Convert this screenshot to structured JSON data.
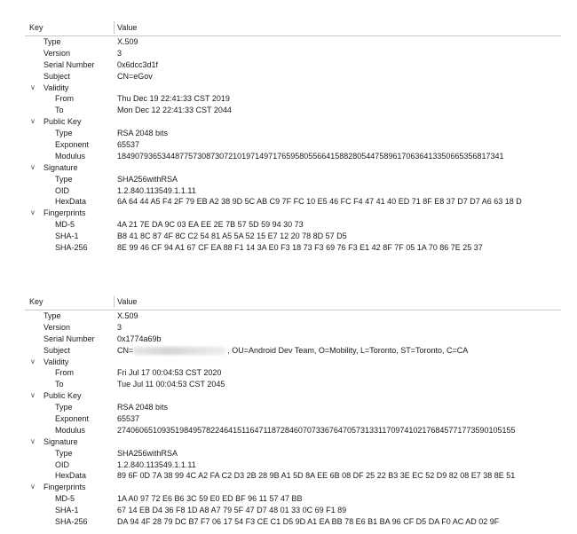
{
  "header": {
    "key_label": "Key",
    "value_label": "Value"
  },
  "certificates": [
    {
      "rows": [
        {
          "level": 1,
          "key": "Type",
          "value": "X.509"
        },
        {
          "level": 1,
          "key": "Version",
          "value": "3"
        },
        {
          "level": 1,
          "key": "Serial Number",
          "value": "0x6dcc3d1f"
        },
        {
          "level": 1,
          "key": "Subject",
          "value": "CN=eGov"
        },
        {
          "level": 1,
          "key": "Validity",
          "value": "",
          "group": true
        },
        {
          "level": 2,
          "key": "From",
          "value": "Thu Dec 19 22:41:33 CST 2019"
        },
        {
          "level": 2,
          "key": "To",
          "value": "Mon Dec 12 22:41:33 CST 2044"
        },
        {
          "level": 1,
          "key": "Public Key",
          "value": "",
          "group": true
        },
        {
          "level": 2,
          "key": "Type",
          "value": "RSA 2048 bits"
        },
        {
          "level": 2,
          "key": "Exponent",
          "value": "65537"
        },
        {
          "level": 2,
          "key": "Modulus",
          "value": "184907936534487757308730721019714971765958055664158828054475896170636413350665356817341"
        },
        {
          "level": 1,
          "key": "Signature",
          "value": "",
          "group": true
        },
        {
          "level": 2,
          "key": "Type",
          "value": "SHA256withRSA"
        },
        {
          "level": 2,
          "key": "OID",
          "value": "1.2.840.113549.1.1.11"
        },
        {
          "level": 2,
          "key": "HexData",
          "value": "6A 64 44 A5 F4 2F 79 EB A2 38 9D 5C AB C9 7F FC 10 E5 46 FC F4 47 41 40 ED 71 8F E8 37 D7 D7 A6 63 18 D"
        },
        {
          "level": 1,
          "key": "Fingerprints",
          "value": "",
          "group": true
        },
        {
          "level": 2,
          "key": "MD-5",
          "value": "4A 21 7E DA 9C 03 EA EE 2E 7B 57 5D 59 94 30 73"
        },
        {
          "level": 2,
          "key": "SHA-1",
          "value": "B8 41 8C 87 4F 8C C2 54 81 A5 5A 52 15 E7 12 20 78 8D 57 D5"
        },
        {
          "level": 2,
          "key": "SHA-256",
          "value": "8E 99 46 CF 94 A1 67 CF EA 88 F1 14 3A E0 F3 18 73 F3 69 76 F3 E1 42 8F 7F 05 1A 70 86 7E 25 37"
        }
      ]
    },
    {
      "rows": [
        {
          "level": 1,
          "key": "Type",
          "value": "X.509"
        },
        {
          "level": 1,
          "key": "Version",
          "value": "3"
        },
        {
          "level": 1,
          "key": "Serial Number",
          "value": "0x1774a69b"
        },
        {
          "level": 1,
          "key": "Subject",
          "value": "CN=",
          "value_suffix": ", OU=Android Dev Team, O=Mobility, L=Toronto, ST=Toronto, C=CA",
          "redacted": true
        },
        {
          "level": 1,
          "key": "Validity",
          "value": "",
          "group": true
        },
        {
          "level": 2,
          "key": "From",
          "value": "Fri Jul 17 00:04:53 CST 2020"
        },
        {
          "level": 2,
          "key": "To",
          "value": "Tue Jul 11 00:04:53 CST 2045"
        },
        {
          "level": 1,
          "key": "Public Key",
          "value": "",
          "group": true
        },
        {
          "level": 2,
          "key": "Type",
          "value": "RSA 2048 bits"
        },
        {
          "level": 2,
          "key": "Exponent",
          "value": "65537"
        },
        {
          "level": 2,
          "key": "Modulus",
          "value": "274060651093519849578224641511647118728460707336764705731331170974102176845771773590105155"
        },
        {
          "level": 1,
          "key": "Signature",
          "value": "",
          "group": true
        },
        {
          "level": 2,
          "key": "Type",
          "value": "SHA256withRSA"
        },
        {
          "level": 2,
          "key": "OID",
          "value": "1.2.840.113549.1.1.11"
        },
        {
          "level": 2,
          "key": "HexData",
          "value": "89 6F 0D 7A 38 99 4C A2 FA C2 D3 2B 28 9B A1 5D 8A EE 6B 08 DF 25 22 B3 3E EC 52 D9 82 08 E7 38 8E 51"
        },
        {
          "level": 1,
          "key": "Fingerprints",
          "value": "",
          "group": true
        },
        {
          "level": 2,
          "key": "MD-5",
          "value": "1A A0 97 72 E6 B6 3C 59 E0 ED BF 96 11 57 47 BB"
        },
        {
          "level": 2,
          "key": "SHA-1",
          "value": "67 14 EB D4 36 F8 1D A8 A7 79 5F 47 D7 48 01 33 0C 69 F1 89"
        },
        {
          "level": 2,
          "key": "SHA-256",
          "value": "DA 94 4F 28 79 DC B7 F7 06 17 54 F3 CE C1 D5 9D A1 EA BB 78 E6 B1 BA 96 CF D5 DA F0 AC AD 02 9F"
        }
      ]
    }
  ]
}
